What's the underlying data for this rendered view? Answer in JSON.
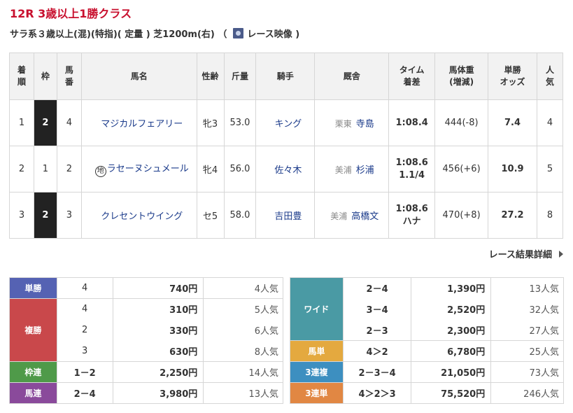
{
  "race": {
    "title": "12R 3歳以上1勝クラス",
    "conditions": "サラ系３歳以上(混)(特指)( 定量 ) 芝1200m(右) （",
    "video_label": "レース映像 )"
  },
  "results_table": {
    "headers": [
      "着順",
      "枠",
      "馬番",
      "馬名",
      "性齢",
      "斤量",
      "騎手",
      "厩舎",
      "タイム着差",
      "馬体重(増減)",
      "単勝オッズ",
      "人気"
    ],
    "header_lines": {
      "rank": [
        "着",
        "順"
      ],
      "waku": "枠",
      "umaban": [
        "馬",
        "番"
      ],
      "horse": "馬名",
      "sexage": "性齢",
      "weight": "斤量",
      "jockey": "騎手",
      "trainer": "厩舎",
      "time": [
        "タイム",
        "着差"
      ],
      "bodyweight": [
        "馬体重",
        "(増減)"
      ],
      "odds": [
        "単勝",
        "オッズ"
      ],
      "pop": [
        "人",
        "気"
      ]
    },
    "rows": [
      {
        "rank": "1",
        "waku": "2",
        "waku_color": "black",
        "umaban": "4",
        "horse": "マジカルフェアリー",
        "chi": "",
        "sexage": "牝3",
        "weight": "53.0",
        "jockey": "キング",
        "aff": "栗東",
        "trainer": "寺島",
        "time": "1:08.4",
        "margin": "",
        "bodyweight": "444(-8)",
        "odds": "7.4",
        "pop": "4"
      },
      {
        "rank": "2",
        "waku": "1",
        "waku_color": "white",
        "umaban": "2",
        "horse": "ラセーヌシュメール",
        "chi": "地",
        "sexage": "牝4",
        "weight": "56.0",
        "jockey": "佐々木",
        "aff": "美浦",
        "trainer": "杉浦",
        "time": "1:08.6",
        "margin": "1.1/4",
        "bodyweight": "456(+6)",
        "odds": "10.9",
        "pop": "5"
      },
      {
        "rank": "3",
        "waku": "2",
        "waku_color": "black",
        "umaban": "3",
        "horse": "クレセントウイング",
        "chi": "",
        "sexage": "セ5",
        "weight": "58.0",
        "jockey": "吉田豊",
        "aff": "美浦",
        "trainer": "高橋文",
        "time": "1:08.6",
        "margin": "ハナ",
        "bodyweight": "470(+8)",
        "odds": "27.2",
        "pop": "8"
      }
    ]
  },
  "detail_link": "レース結果詳細",
  "payouts_left": {
    "tansho": {
      "label": "単勝",
      "entries": [
        {
          "nums": "4",
          "amount": "740円",
          "pop": "4人気"
        }
      ]
    },
    "fukusho": {
      "label": "複勝",
      "entries": [
        {
          "nums": "4",
          "amount": "310円",
          "pop": "5人気"
        },
        {
          "nums": "2",
          "amount": "330円",
          "pop": "6人気"
        },
        {
          "nums": "3",
          "amount": "630円",
          "pop": "8人気"
        }
      ]
    },
    "wakuren": {
      "label": "枠連",
      "entries": [
        {
          "nums": "1－2",
          "amount": "2,250円",
          "pop": "14人気"
        }
      ]
    },
    "umaren": {
      "label": "馬連",
      "entries": [
        {
          "nums": "2－4",
          "amount": "3,980円",
          "pop": "13人気"
        }
      ]
    }
  },
  "payouts_right": {
    "wide": {
      "label": "ワイド",
      "entries": [
        {
          "nums": "2－4",
          "amount": "1,390円",
          "pop": "13人気"
        },
        {
          "nums": "3－4",
          "amount": "2,520円",
          "pop": "32人気"
        },
        {
          "nums": "2－3",
          "amount": "2,300円",
          "pop": "27人気"
        }
      ]
    },
    "umatan": {
      "label": "馬単",
      "entries": [
        {
          "nums": "4＞2",
          "amount": "6,780円",
          "pop": "25人気"
        }
      ]
    },
    "sanrenpuku": {
      "label": "3連複",
      "entries": [
        {
          "nums": "2－3－4",
          "amount": "21,050円",
          "pop": "73人気"
        }
      ]
    },
    "sanrentan": {
      "label": "3連単",
      "entries": [
        {
          "nums": "4＞2＞3",
          "amount": "75,520円",
          "pop": "246人気"
        }
      ]
    }
  },
  "colors": {
    "title_red": "#c8102e",
    "link_blue": "#1a3a8a",
    "tansho": "#5562b3",
    "fukusho": "#c9484b",
    "wakuren": "#4f9a49",
    "umaren": "#8a4a9b",
    "wide": "#4a9aa4",
    "umatan": "#e4a93f",
    "sanrenpuku": "#3d8fc0",
    "sanrentan": "#e18743"
  },
  "icons": {
    "video": "video-thumbnail-icon",
    "detail_arrow": "triangle-right-icon",
    "chi": "circled-chi-mark"
  }
}
